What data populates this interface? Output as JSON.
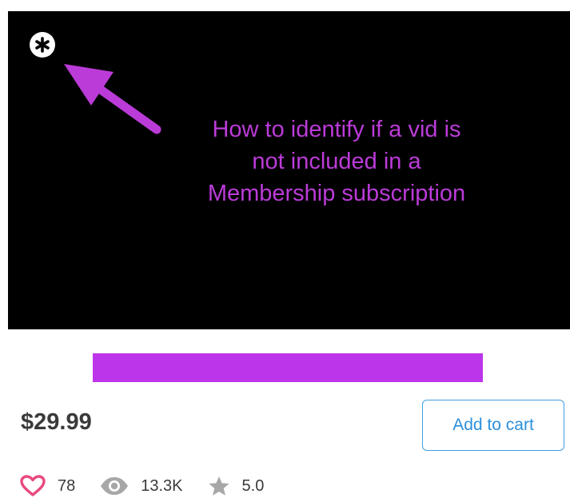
{
  "video": {
    "badge_icon": "asterisk-icon",
    "arrow_icon": "arrow-pointer-icon",
    "caption_lines": [
      "How to identify if a vid is",
      "not included in a",
      "Membership subscription"
    ],
    "caption_color": "#bb3bd8"
  },
  "title_redaction_color": "#bd35ea",
  "price": "$29.99",
  "cart_button": {
    "label": "Add to cart",
    "color": "#2b8fdb"
  },
  "stats": {
    "likes": {
      "icon": "heart-icon",
      "value": "78",
      "color": "#e84a7f"
    },
    "views": {
      "icon": "eye-icon",
      "value": "13.3K"
    },
    "rating": {
      "icon": "star-icon",
      "value": "5.0"
    }
  }
}
